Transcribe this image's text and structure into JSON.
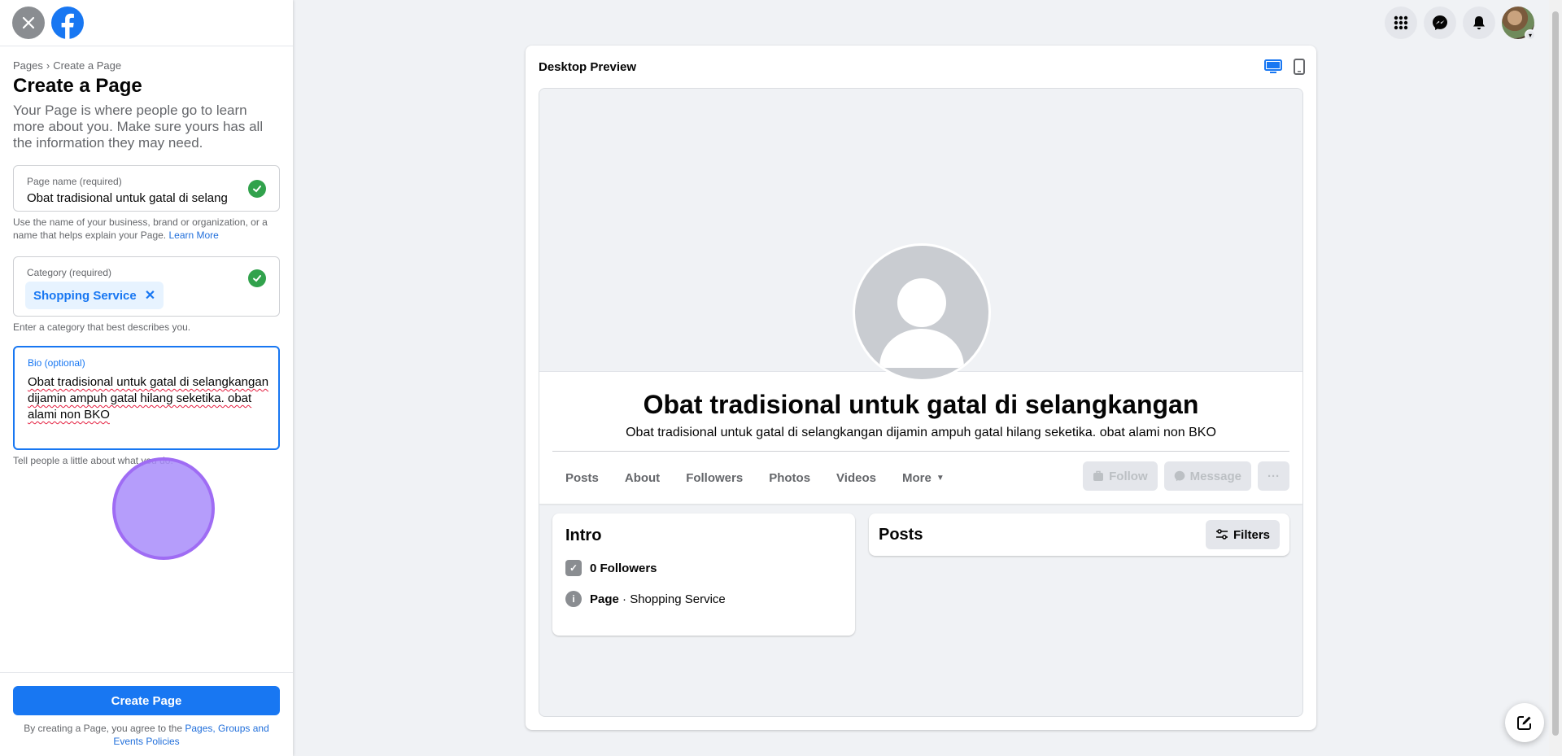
{
  "left_panel": {
    "breadcrumb": [
      "Pages",
      "›",
      "Create a Page"
    ],
    "title": "Create a Page",
    "description": "Your Page is where people go to learn more about you. Make sure yours has all the information they may need.",
    "page_name": {
      "label": "Page name (required)",
      "value": "Obat tradisional untuk gatal di selang",
      "helper": "Use the name of your business, brand or organization, or a name that helps explain your Page.",
      "helper_link": "Learn More"
    },
    "category": {
      "label": "Category (required)",
      "chip": "Shopping Service",
      "helper": "Enter a category that best describes you."
    },
    "bio": {
      "label": "Bio (optional)",
      "value": "Obat tradisional untuk gatal di selangkangan dijamin ampuh gatal hilang seketika. obat alami non BKO",
      "helper": "Tell people a little about what you do."
    },
    "create_button": "Create Page",
    "policy_prefix": "By creating a Page, you agree to the",
    "policy_link": "Pages, Groups and Events Policies"
  },
  "preview": {
    "title": "Desktop Preview",
    "page_name": "Obat tradisional untuk gatal di selangkangan",
    "page_bio": "Obat tradisional untuk gatal di selangkangan dijamin ampuh gatal hilang seketika. obat alami non BKO",
    "tabs": [
      "Posts",
      "About",
      "Followers",
      "Photos",
      "Videos",
      "More"
    ],
    "actions": {
      "follow": "Follow",
      "message": "Message",
      "more": "···"
    },
    "intro": {
      "title": "Intro",
      "followers": "0 Followers",
      "page_label": "Page",
      "page_category": " · Shopping Service"
    },
    "posts": {
      "title": "Posts",
      "filters": "Filters"
    }
  },
  "colors": {
    "accent": "#1877f2",
    "check": "#31a24c",
    "cursor": "#a88cfa"
  }
}
